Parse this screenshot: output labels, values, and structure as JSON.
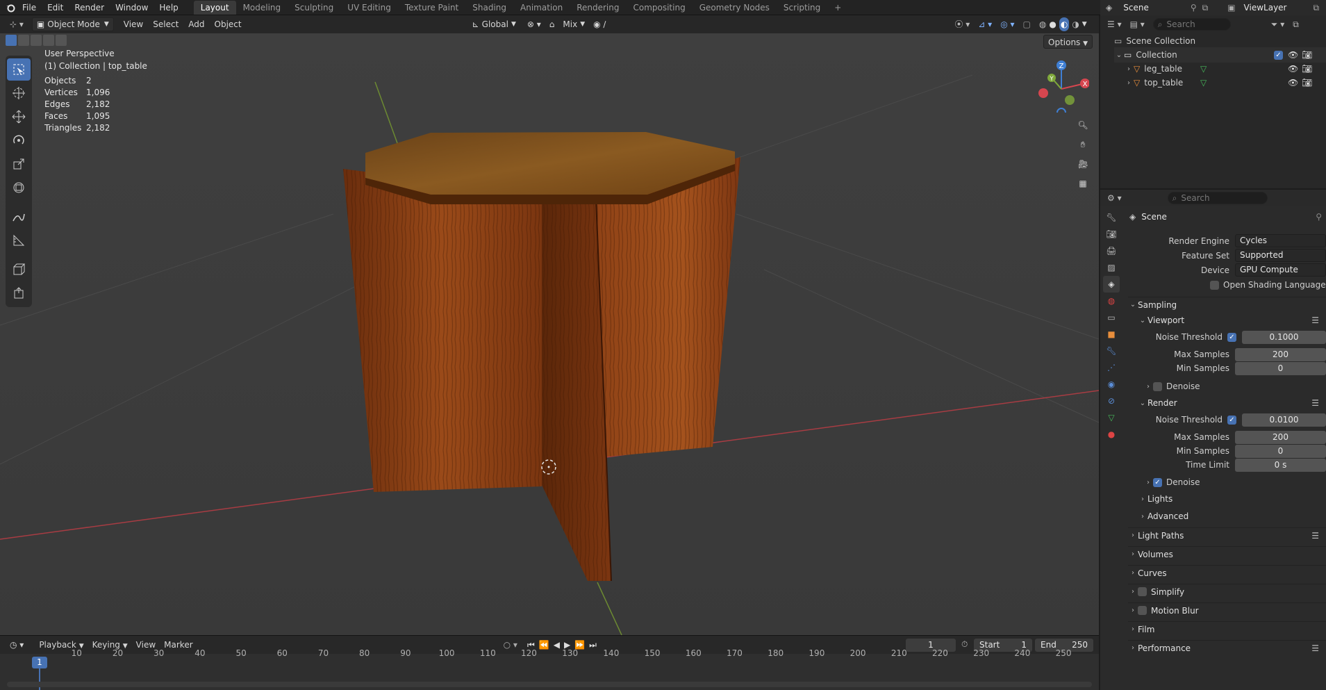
{
  "colors": {
    "accent": "#4772b3",
    "axis_x": "#d6464f",
    "axis_y": "#7fa83a",
    "axis_z": "#3f7fd4",
    "wood": "#8a3f14"
  },
  "menu": [
    "File",
    "Edit",
    "Render",
    "Window",
    "Help"
  ],
  "workspaces": [
    "Layout",
    "Modeling",
    "Sculpting",
    "UV Editing",
    "Texture Paint",
    "Shading",
    "Animation",
    "Rendering",
    "Compositing",
    "Geometry Nodes",
    "Scripting"
  ],
  "active_workspace": "Layout",
  "topright": {
    "scene": "Scene",
    "view_layer": "ViewLayer"
  },
  "vpheader": {
    "mode": "Object Mode",
    "menus": [
      "View",
      "Select",
      "Add",
      "Object"
    ],
    "orientation": "Global",
    "blend": "Mix",
    "options": "Options"
  },
  "overlay": {
    "perspective": "User Perspective",
    "context": "(1) Collection | top_table",
    "stats": [
      {
        "label": "Objects",
        "value": "2"
      },
      {
        "label": "Vertices",
        "value": "1,096"
      },
      {
        "label": "Edges",
        "value": "2,182"
      },
      {
        "label": "Faces",
        "value": "1,095"
      },
      {
        "label": "Triangles",
        "value": "2,182"
      }
    ]
  },
  "gizmo": {
    "x": "X",
    "y": "Y",
    "z": "Z"
  },
  "tools": [
    "select-box-icon",
    "cursor-icon",
    "move-icon",
    "rotate-icon",
    "scale-icon",
    "transform-icon",
    "annotate-icon",
    "measure-icon",
    "add-cube-icon",
    "extrude-icon"
  ],
  "timeline": {
    "menus": [
      "Playback",
      "Keying",
      "View",
      "Marker"
    ],
    "current_frame": "1",
    "start_label": "Start",
    "start": "1",
    "end_label": "End",
    "end": "250",
    "ticks": [
      "1",
      "10",
      "20",
      "30",
      "40",
      "50",
      "60",
      "70",
      "80",
      "90",
      "100",
      "110",
      "120",
      "130",
      "140",
      "150",
      "160",
      "170",
      "180",
      "190",
      "200",
      "210",
      "220",
      "230",
      "240",
      "250"
    ]
  },
  "outliner": {
    "search": "Search",
    "scene_collection": "Scene Collection",
    "collection": "Collection",
    "objects": [
      "leg_table",
      "top_table"
    ]
  },
  "properties": {
    "search": "Search",
    "context": "Scene",
    "render_engine_label": "Render Engine",
    "render_engine": "Cycles",
    "feature_set_label": "Feature Set",
    "feature_set": "Supported",
    "device_label": "Device",
    "device": "GPU Compute",
    "osl": "Open Shading Language",
    "sampling": "Sampling",
    "viewport": "Viewport",
    "render": "Render",
    "noise_threshold": "Noise Threshold",
    "max_samples": "Max Samples",
    "min_samples": "Min Samples",
    "time_limit": "Time Limit",
    "vp_noise": "0.1000",
    "vp_max": "200",
    "vp_min": "0",
    "denoise": "Denoise",
    "r_noise": "0.0100",
    "r_max": "200",
    "r_min": "0",
    "r_time": "0 s",
    "lights": "Lights",
    "advanced": "Advanced",
    "panels": [
      "Light Paths",
      "Volumes",
      "Curves",
      "Simplify",
      "Motion Blur",
      "Film",
      "Performance"
    ]
  }
}
